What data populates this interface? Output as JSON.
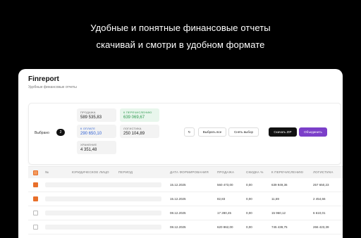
{
  "hero": {
    "line1": "Удобные и понятные финансовые отчеты",
    "line2": "скачивай и смотри в удобном формате"
  },
  "app": {
    "name": "Finreport",
    "subtitle": "Удобные финансовые отчеты"
  },
  "summary": {
    "selected_label": "Выбрано",
    "selected_count": "2",
    "sales": {
      "caption": "ПРОДАЖА",
      "value": "589 535,83"
    },
    "to_transfer": {
      "caption": "К ПЕРЕЧИСЛЕНИЮ",
      "value": "639 069,67"
    },
    "to_pay": {
      "caption": "К ОПЛАТЕ",
      "value": "290 650,10"
    },
    "logistics": {
      "caption": "ЛОГИСТИКА",
      "value": "250 104,89"
    },
    "storage": {
      "caption": "ХРАНЕНИЕ",
      "value": "4 351,48"
    }
  },
  "actions": {
    "refresh_icon": "refresh-icon",
    "refresh_glyph": "↻",
    "select_all": "Выбрать все",
    "clear_selection": "Снять выбор",
    "download_zip": "Скачать ZIP",
    "merge": "Объединить"
  },
  "colors": {
    "accent_purple": "#7b3fc9",
    "checkbox_orange": "#e86f2a",
    "positive_green": "#2e9a4f",
    "link_blue": "#2d5fd3"
  },
  "table": {
    "columns": [
      "№",
      "ЮРИДИЧЕСКОЕ ЛИЦО",
      "ПЕРИОД",
      "ДАТА ФОРМИРОВАНИЯ",
      "ПРОДАЖА",
      "СКИДКА %",
      "К ПЕРЕЧИСЛЕНИЮ",
      "ЛОГИСТИКА"
    ],
    "rows": [
      {
        "date": "15.12.2025",
        "sales": "560 473,00",
        "discount": "0,00",
        "transfer": "639 949,36",
        "logistics": "257 650,23"
      },
      {
        "date": "15.12.2025",
        "sales": "82,83",
        "discount": "0,00",
        "transfer": "11,69",
        "logistics": "2 454,66"
      },
      {
        "date": "08.12.2025",
        "sales": "17 280,45",
        "discount": "0,00",
        "transfer": "15 960,12",
        "logistics": "6 610,01"
      },
      {
        "date": "08.12.2025",
        "sales": "620 862,00",
        "discount": "0,00",
        "transfer": "745 439,75",
        "logistics": "266 423,39"
      }
    ]
  }
}
